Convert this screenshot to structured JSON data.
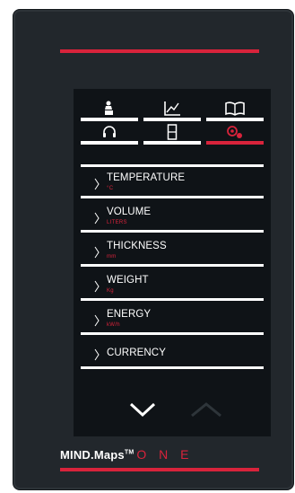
{
  "brand": {
    "name": "MIND.Maps",
    "tm": "TM",
    "suffix": "O N E"
  },
  "colors": {
    "accent": "#d8233b",
    "screen": "#0f1317",
    "body": "#22272c",
    "text": "#ffffff",
    "disabled": "#2e353a"
  },
  "mode_icons": [
    {
      "name": "chef-hat-icon",
      "active": false
    },
    {
      "name": "chart-icon",
      "active": false
    },
    {
      "name": "book-icon",
      "active": false
    },
    {
      "name": "headset-icon",
      "active": false
    },
    {
      "name": "device-icon",
      "active": false
    },
    {
      "name": "settings-gear-icon",
      "active": true
    }
  ],
  "units_list": [
    {
      "label": "TEMPERATURE",
      "unit": "°C"
    },
    {
      "label": "VOLUME",
      "unit": "LITERS"
    },
    {
      "label": "THICKNESS",
      "unit": "mm"
    },
    {
      "label": "WEIGHT",
      "unit": "Kg"
    },
    {
      "label": "ENERGY",
      "unit": "kW/h"
    },
    {
      "label": "CURRENCY",
      "unit": ""
    }
  ],
  "nav": {
    "down_enabled": true,
    "up_enabled": false
  }
}
